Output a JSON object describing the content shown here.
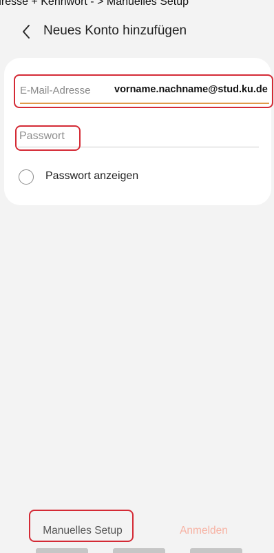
{
  "caption": "dresse + Kennwort - > Manuelles Setup",
  "header": {
    "back_icon": "chevron-left-icon",
    "title": "Neues Konto hinzufügen"
  },
  "form": {
    "email_placeholder": "E-Mail-Adresse",
    "email_value": "vorname.nachname@stud.ku.de",
    "password_placeholder": "Passwort",
    "show_password_label": "Passwort anzeigen",
    "show_password_checked": false
  },
  "actions": {
    "manual_setup_label": "Manuelles Setup",
    "sign_in_label": "Anmelden"
  },
  "colors": {
    "highlight": "#d42a35",
    "accent_underline": "#e09a4a",
    "sign_in_disabled": "#f7b2a3"
  }
}
